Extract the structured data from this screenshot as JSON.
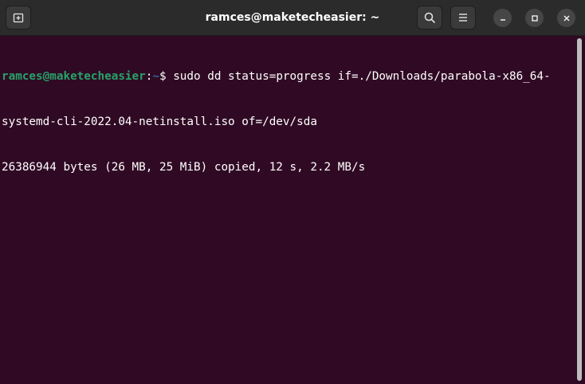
{
  "window": {
    "title": "ramces@maketecheasier: ~"
  },
  "titlebar": {
    "buttons": [
      {
        "icon": "new-tab-icon"
      },
      {
        "icon": "search-icon"
      },
      {
        "icon": "hamburger-menu-icon"
      }
    ],
    "window_controls": [
      "minimize-icon",
      "maximize-icon",
      "close-icon"
    ]
  },
  "terminal": {
    "prompt_user": "ramces@maketecheasier",
    "prompt_colon": ":",
    "prompt_path": "~",
    "prompt_symbol": "$",
    "command_line1": " sudo dd status=progress if=./Downloads/parabola-x86_64-",
    "command_line2": "systemd-cli-2022.04-netinstall.iso of=/dev/sda",
    "output_line": "26386944 bytes (26 MB, 25 MiB) copied, 12 s, 2.2 MB/s"
  },
  "colors": {
    "terminal_background": "#300a24",
    "titlebar_background": "#2b2b2b",
    "prompt_user": "#26a269",
    "prompt_path": "#3464a3",
    "text": "#ffffff"
  }
}
